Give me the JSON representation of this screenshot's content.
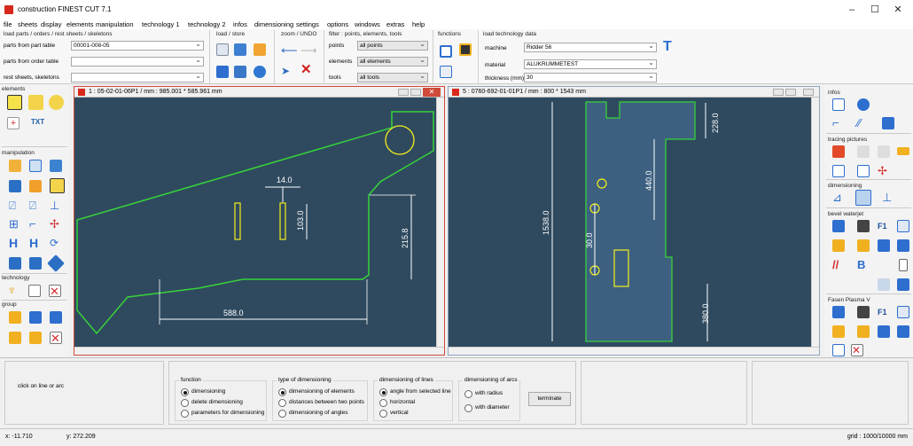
{
  "app": {
    "title": "construction FINEST CUT 7.1",
    "controls": [
      "–",
      "☐",
      "✕"
    ]
  },
  "menu": [
    "file",
    "sheets",
    "display",
    "elements",
    "manipulation",
    "technology 1",
    "technology 2",
    "infos",
    "dimensioning",
    "settings",
    "options",
    "windows",
    "extras",
    "help"
  ],
  "ribbon": {
    "load_parts": {
      "title": "load parts / orders / rest sheets / skeletons",
      "rows": [
        {
          "label": "parts from part table",
          "value": "00001-008-05"
        },
        {
          "label": "parts from order table",
          "value": ""
        },
        {
          "label": "rest sheets, skeletons",
          "value": ""
        }
      ]
    },
    "load_store": {
      "title": "load / store"
    },
    "zoom": {
      "title": "zoom / UNDO"
    },
    "filter": {
      "title": "filter : points, elements, tools",
      "rows": [
        {
          "label": "points",
          "value": "all points"
        },
        {
          "label": "elements",
          "value": "all elements"
        },
        {
          "label": "tools",
          "value": "all tools"
        }
      ]
    },
    "functions": {
      "title": "functions"
    },
    "tech": {
      "title": "load technology data",
      "rows": [
        {
          "label": "machine",
          "value": "Ridder 56"
        },
        {
          "label": "material",
          "value": "ALUKRUMMETEST"
        },
        {
          "label": "thickness (mm)",
          "value": "30"
        }
      ]
    }
  },
  "left_palette": {
    "elements": "elements",
    "txt": "TXT",
    "manipulation": "manipulation",
    "technology": "technology",
    "group": "group"
  },
  "right_palette": {
    "infos": "infos",
    "tracing": "tracing pictures",
    "dimensioning": "dimensioning",
    "bevel": "bevel waterjet",
    "fasen": "Fasen Plasma V"
  },
  "window1": {
    "title": "1 : 05-02-01-06P1   /  mm : 985.001 * 585.961  mm",
    "dims": {
      "d1": "14.0",
      "d2": "103.0",
      "d3": "215.8",
      "d4": "588.0"
    }
  },
  "window2": {
    "title": "5 : 0760-692-01-01P1   /  mm : 800 * 1543  mm",
    "dims": {
      "d1": "228.0",
      "d2": "440.0",
      "d3": "1538.0",
      "d4": "30.0",
      "d5": "380.0"
    }
  },
  "bottom": {
    "hint": "click on line or arc",
    "function": {
      "title": "function",
      "options": [
        "dimensioning",
        "delete dimensioning",
        "parameters for dimensioning"
      ],
      "selected": 0
    },
    "type": {
      "title": "type of dimensioning",
      "options": [
        "dimensioning of elements",
        "distances between two points",
        "dimensioning of angles"
      ],
      "selected": 0
    },
    "lines": {
      "title": "dimensioning of lines",
      "options": [
        "angle from selected line",
        "horizontal",
        "vertical"
      ],
      "selected": 0
    },
    "arcs": {
      "title": "dimensioning of arcs",
      "options": [
        "with radius",
        "with diameter"
      ],
      "selected": -1
    },
    "terminate": "terminate"
  },
  "status": {
    "x": "x: -11.710",
    "y": "y: 272.209",
    "grid": "grid : 1000/10000 mm"
  },
  "colors": {
    "canvas": "#2f4a5f",
    "part_line": "#37d23a",
    "dim": "#ffffff",
    "highlight": "#f4ef1c",
    "part_fill": "#3d6080"
  }
}
